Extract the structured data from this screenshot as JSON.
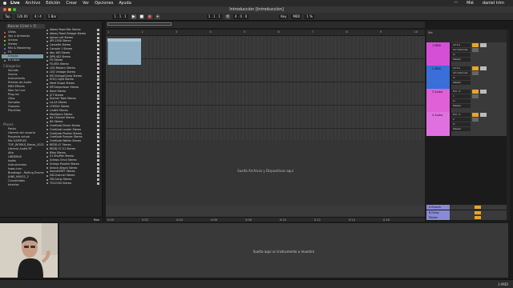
{
  "menubar": {
    "app": "Live",
    "items": [
      "Archivo",
      "Edición",
      "Crear",
      "Ver",
      "Opciones",
      "Ayuda"
    ],
    "user": "daniel trim",
    "day": "Mié"
  },
  "window": {
    "title": "Introducción  [Introducción]"
  },
  "transport": {
    "tap": "Tap",
    "tempo": "120.00",
    "meter": "4 / 4",
    "quant": "1 Bar",
    "position": "1 . 1 . 1",
    "loop_start": "1 . 1 . 1",
    "loop_length": "4 . 0 . 0",
    "key": "Key",
    "midi": "MIDI",
    "cpu": "1 %"
  },
  "browser": {
    "search_placeholder": "Buscar (Cmd + F)",
    "collections_title": "Colecciones",
    "collections": [
      {
        "label": "Útiles",
        "color": "#e05a4a"
      },
      {
        "label": "Voy a Armonías",
        "color": "#e09a3a"
      },
      {
        "label": "Arcano",
        "color": "#e0d040"
      },
      {
        "label": "Stereo",
        "color": "#5ac06a"
      },
      {
        "label": "Mix & Mastering",
        "color": "#5a9ae0"
      },
      {
        "label": "FX",
        "color": "#a06ae0"
      },
      {
        "label": "Grupos",
        "color": "#999999"
      },
      {
        "label": "Es clave",
        "color": "#999999"
      }
    ],
    "categories_title": "Categorías",
    "categories": [
      "Sounds",
      "Drums",
      "Instruments",
      "Efectos de Audio",
      "MIDI Effects",
      "Max for Live",
      "Plug-ins",
      "Clips",
      "Samples",
      "Grooves",
      "Plantillas"
    ],
    "places_title": "Places",
    "places": [
      "Packs",
      "Librería del usuario",
      "Proyecto actual",
      "Mis SAMPLES",
      "TOP_WORKS_Marzo_2022",
      "Librería Audio RT",
      "Alto",
      "LIBRERAS",
      "Isaiás",
      "instrumentos",
      "Isaac-icon",
      "Breakage - Rolling Drums",
      "JUNE_MAY22_2",
      "Convertidos",
      "Interfaz"
    ],
    "files": [
      "Abbey Road 60s Stereo",
      "Abbey Road Vintage Stereo",
      "Aphex Lofi Stereo",
      "API-2500 Stereo",
      "Cassette Stereo",
      "Console 1 Stereo",
      "dbx 160 Stereo",
      "DPR-402 Stereo",
      "FG Stereo",
      "FG-BTA Stereo",
      "LEQ Modern Stereo",
      "LEQ Vintage Stereo",
      "MS VintageComp Stereo",
      "M-EQ Light Stereo",
      "Meet Scope Stereo",
      "MFCompressor Stereo",
      "Neve Stereo",
      "JCT Stereo",
      "Kramer Tape Stereo",
      "LA-2A Stereo",
      "LFHSSX Stereo",
      "Lindell Stereo",
      "MaxSpecs Stereo",
      "Nx Channel Stereo",
      "NS Stereo",
      "OneKnob Driver Stereo",
      "OneKnob Louder Stereo",
      "OneKnob Phatter Stereo",
      "OneKnob Pumper Stereo",
      "OneKnob Wetter Stereo",
      "REDD.47 Stereo",
      "REDD.37-51 Stereo",
      "RVox Stereo",
      "S1 Shuffler Stereo",
      "Scheps Omni Stereo",
      "Scheps Parallel Stereo",
      "Smack Attack Stereo",
      "SoundSHIFT Stereo",
      "SSLChannel Stereo",
      "SSLComp Stereo",
      "TG12345 Stereo"
    ],
    "footer_label": "Raw"
  },
  "arrangement": {
    "ruler": [
      "1",
      "2",
      "3",
      "4",
      "5",
      "6",
      "7",
      "8",
      "9",
      "10"
    ],
    "drop_text": "Suelta Archivos y Dispositivos aquí",
    "times": [
      "0:00",
      "0:02",
      "0:04",
      "0:06",
      "0:08",
      "0:10",
      "0:12",
      "0:14",
      "0:16"
    ]
  },
  "tracks": [
    {
      "name": "1 MIDI",
      "color": "#d54fd6",
      "input": "All Ins",
      "channel": "All Channels",
      "mon": "In",
      "output": "Master",
      "num": "1"
    },
    {
      "name": "2 MIDI",
      "color": "#3a6ed8",
      "input": "All Ins",
      "channel": "All Channels",
      "mon": "In",
      "output": "Master",
      "num": "2"
    },
    {
      "name": "3 Audio",
      "color": "#e060d8",
      "input": "Ext. In",
      "channel": "1",
      "mon": "In",
      "output": "Master",
      "num": "3"
    },
    {
      "name": "4 Audio",
      "color": "#e070e0",
      "input": "Ext. In",
      "channel": "2",
      "mon": "In",
      "output": "Master",
      "num": "4"
    }
  ],
  "returns": [
    {
      "name": "A Reverb",
      "color": "#8a8ad8"
    },
    {
      "name": "B Delay",
      "color": "#8a8ad8"
    },
    {
      "name": "Master",
      "color": "#8a8ad8"
    }
  ],
  "mixer": {
    "set_label": "Set"
  },
  "detail": {
    "drop_text": "Suelta aquí un Instrumento o muestra"
  },
  "status": {
    "track_num": "1-MIDI"
  }
}
